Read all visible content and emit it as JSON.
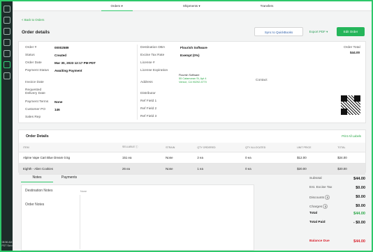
{
  "nav": {
    "tabs": [
      "Orders ▾",
      "Shipments ▾",
      "Transfers"
    ]
  },
  "rail": {
    "time": "08:56 AM PDT Scro"
  },
  "header": {
    "back": "< Back to Orders",
    "title": "Order details",
    "sync": "Sync to QuickBooks",
    "export": "Export PDF ▾",
    "edit": "Edit Order"
  },
  "order": {
    "labels": [
      "Order #",
      "Status",
      "Order Date",
      "Payment Status",
      "Invoice Date",
      "Requested Delivery Date",
      "Payment Terms",
      "Customer PO",
      "Sales Rep"
    ],
    "values": [
      "00002589",
      "Created",
      "Mar 30, 2023 12:17 PM PDT",
      "Awaiting Payment",
      "",
      "",
      "None",
      "146",
      ""
    ]
  },
  "dest": {
    "labels": [
      "Destination DBA",
      "Excise Tax Rate",
      "License #",
      "License Expiration",
      "Address",
      "Distributor",
      "Ref Field 1",
      "Ref Field 2",
      "Ref Field 3"
    ],
    "dba": "Flourish Software",
    "tax": "Exempt (0%)",
    "addr_name": "Flourish Software",
    "addr1": "55 Catamaran St, Apt 4",
    "addr2": "Venice, CA 90292-5770",
    "contact": "Contact"
  },
  "total": {
    "label": "Order Total",
    "value": "$44.00"
  },
  "details": {
    "title": "Order Details",
    "print": "Print All Labels",
    "columns": [
      "ITEM",
      "SELLABLE ⓘ",
      "STRAIN",
      "QTY ORDERED",
      "QTY ALLOCATED",
      "UNIT PRICE",
      "TOTAL"
    ],
    "rows": [
      [
        "Alpine Vape Cart Blue Dream 0.5g",
        "151 ea",
        "None",
        "2 ea",
        "0 ea",
        "$12.00",
        "$24.00"
      ],
      [
        "Eighth - Alien Cookies",
        "26 ea",
        "None",
        "1 ea",
        "0 ea",
        "$20.00",
        "$20.00"
      ]
    ]
  },
  "notes": {
    "tabs": [
      "Notes",
      "Payments"
    ],
    "dest_label": "Destination Notes",
    "dest_val": "None",
    "order_label": "Order Notes"
  },
  "summary": {
    "subtotal": [
      "Subtotal",
      "$44.00"
    ],
    "excise": [
      "Est. Excise Tax",
      "$0.00"
    ],
    "discounts": [
      "Discounts",
      "$0.00"
    ],
    "charges": [
      "Charges",
      "$0.00"
    ],
    "total": [
      "Total",
      "$44.00"
    ],
    "paid": [
      "Total Paid",
      "- $0.00"
    ],
    "due": [
      "Balance Due",
      "$44.00"
    ]
  }
}
